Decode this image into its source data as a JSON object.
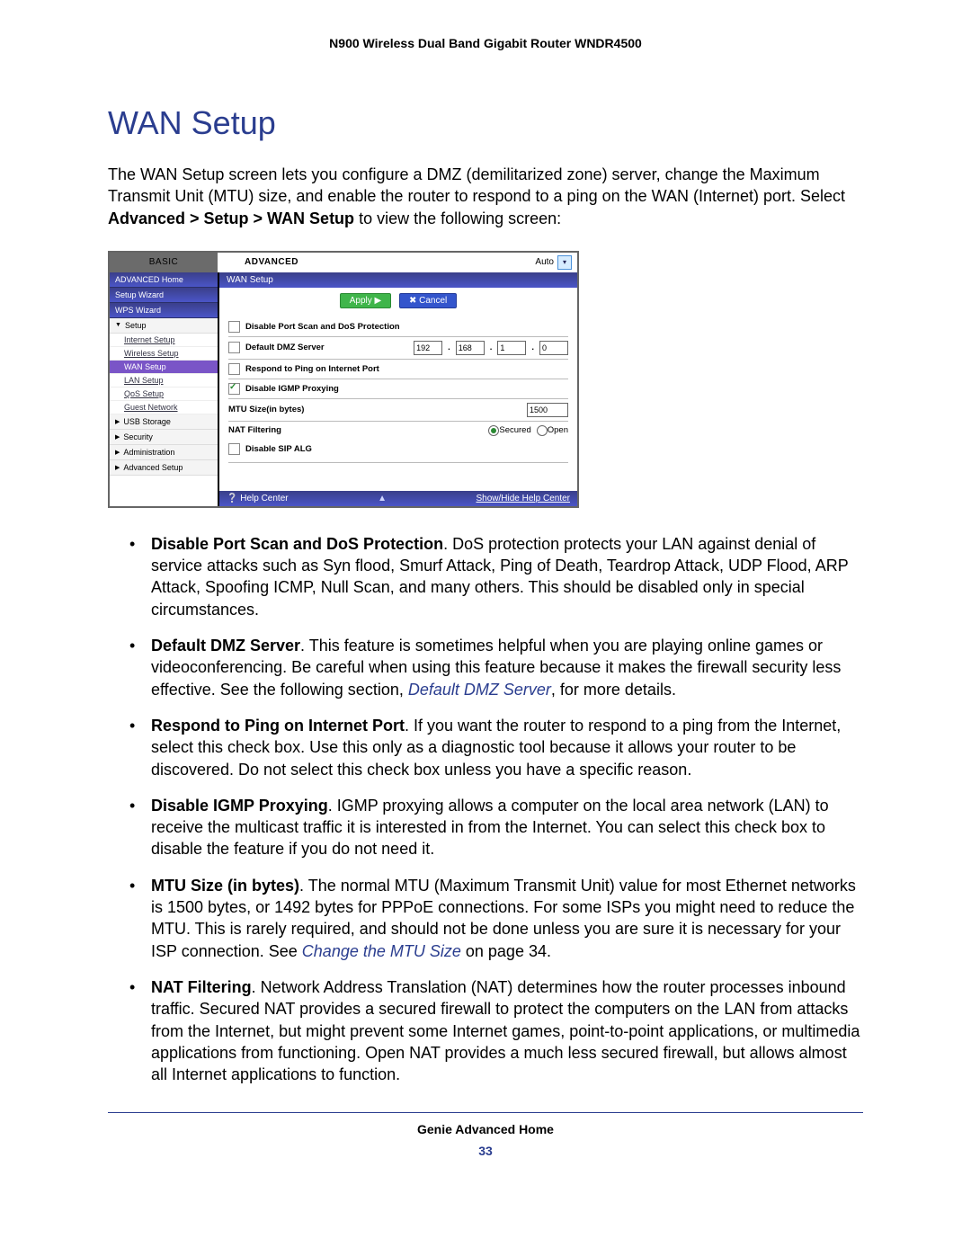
{
  "doc_header": "N900 Wireless Dual Band Gigabit Router WNDR4500",
  "title": "WAN Setup",
  "intro": {
    "p1a": "The WAN Setup screen lets you configure a DMZ (demilitarized zone) server, change the Maximum Transmit Unit (MTU) size, and enable the router to respond to a ping on the WAN (Internet) port. Select ",
    "p1b": "Advanced > Setup > WAN Setup",
    "p1c": " to view the following screen:"
  },
  "screenshot": {
    "tab_basic": "BASIC",
    "tab_advanced": "ADVANCED",
    "auto_label": "Auto",
    "nav": {
      "home": "ADVANCED Home",
      "setup_wizard": "Setup Wizard",
      "wps_wizard": "WPS Wizard",
      "setup_section": "Setup",
      "setup_items": [
        "Internet Setup",
        "Wireless Setup",
        "WAN Setup",
        "LAN Setup",
        "QoS Setup",
        "Guest Network"
      ],
      "usb": "USB Storage",
      "security": "Security",
      "admin": "Administration",
      "adv_setup": "Advanced Setup"
    },
    "main_header": "WAN Setup",
    "btn_apply": "Apply ▶",
    "btn_cancel": "✖ Cancel",
    "rows": {
      "disable_portscan": "Disable Port Scan and DoS Protection",
      "default_dmz": "Default DMZ Server",
      "dmz_ip": [
        "192",
        "168",
        "1",
        "0"
      ],
      "respond_ping": "Respond to Ping on Internet Port",
      "disable_igmp": "Disable IGMP Proxying",
      "mtu_label": "MTU Size(in bytes)",
      "mtu_value": "1500",
      "nat_label": "NAT Filtering",
      "nat_secured": "Secured",
      "nat_open": "Open",
      "disable_sip": "Disable SIP ALG"
    },
    "helpbar_left": "❔ Help Center",
    "helpbar_right": "Show/Hide Help Center"
  },
  "bullets": {
    "b1": {
      "head": "Disable Port Scan and DoS Protection",
      "body": ". DoS protection protects your LAN against denial of service attacks such as Syn flood, Smurf Attack, Ping of Death, Teardrop Attack, UDP Flood, ARP Attack, Spoofing ICMP, Null Scan, and many others. This should be disabled only in special circumstances."
    },
    "b2": {
      "head": "Default DMZ Server",
      "body1": ". This feature is sometimes helpful when you are playing online games or videoconferencing. Be careful when using this feature because it makes the firewall security less effective. See the following section, ",
      "link": "Default DMZ Server",
      "body2": ", for more details."
    },
    "b3": {
      "head": "Respond to Ping on Internet Port",
      "body": ". If you want the router to respond to a ping from the Internet, select this check box. Use this only as a diagnostic tool because it allows your router to be discovered. Do not select this check box unless you have a specific reason."
    },
    "b4": {
      "head": "Disable IGMP Proxying",
      "body": ". IGMP proxying allows a computer on the local area network (LAN) to receive the multicast traffic it is interested in from the Internet. You can select this check box to disable the feature if you do not need it."
    },
    "b5": {
      "head": "MTU Size (in bytes)",
      "body1": ". The normal MTU (Maximum Transmit Unit) value for most Ethernet networks is 1500 bytes, or 1492 bytes for PPPoE connections. For some ISPs you might need to reduce the MTU. This is rarely required, and should not be done unless you are sure it is necessary for your ISP connection. See ",
      "link": "Change the MTU Size",
      "body2": " on page 34."
    },
    "b6": {
      "head": "NAT Filtering",
      "body": ". Network Address Translation (NAT) determines how the router processes inbound traffic. Secured NAT provides a secured firewall to protect the computers on the LAN from attacks from the Internet, but might prevent some Internet games, point-to-point applications, or multimedia applications from functioning. Open NAT provides a much less secured firewall, but allows almost all Internet applications to function."
    }
  },
  "footer_label": "Genie Advanced Home",
  "footer_page": "33"
}
